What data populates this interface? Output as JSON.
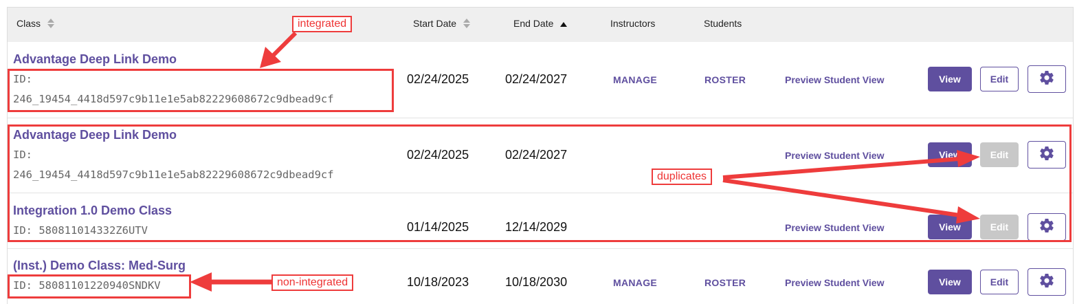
{
  "header": {
    "class": "Class",
    "start_date": "Start Date",
    "end_date": "End Date",
    "instructors": "Instructors",
    "students": "Students"
  },
  "rows": [
    {
      "title": "Advantage Deep Link Demo",
      "id_label": "ID:",
      "id_value": "246_19454_4418d597c9b11e1e5ab82229608672c9dbead9cf",
      "start": "02/24/2025",
      "end": "02/24/2027",
      "instructors": "MANAGE",
      "students": "ROSTER",
      "preview": "Preview Student View",
      "view": "View",
      "edit": "Edit",
      "edit_disabled": false
    },
    {
      "title": "Advantage Deep Link Demo",
      "id_label": "ID:",
      "id_value": "246_19454_4418d597c9b11e1e5ab82229608672c9dbead9cf",
      "start": "02/24/2025",
      "end": "02/24/2027",
      "instructors": "",
      "students": "",
      "preview": "Preview Student View",
      "view": "View",
      "edit": "Edit",
      "edit_disabled": true
    },
    {
      "title": "Integration 1.0 Demo Class",
      "id_full": "ID: 580811014332Z6UTV",
      "start": "01/14/2025",
      "end": "12/14/2029",
      "instructors": "",
      "students": "",
      "preview": "Preview Student View",
      "view": "View",
      "edit": "Edit",
      "edit_disabled": true
    },
    {
      "title": "(Inst.) Demo Class: Med-Surg",
      "id_full": "ID: 58081101220940SNDKV",
      "start": "10/18/2023",
      "end": "10/18/2030",
      "instructors": "MANAGE",
      "students": "ROSTER",
      "preview": "Preview Student View",
      "view": "View",
      "edit": "Edit",
      "edit_disabled": false
    }
  ],
  "annotations": {
    "integrated": "integrated",
    "duplicates": "duplicates",
    "non_integrated": "non-integrated"
  },
  "icons": {
    "sort": "sort-icon",
    "sort_asc": "sort-ascending-icon",
    "settings": "gear-icon"
  },
  "colors": {
    "brand": "#5f4f9f",
    "annotation": "#ee3c3c",
    "disabled": "#c8c8c8"
  }
}
